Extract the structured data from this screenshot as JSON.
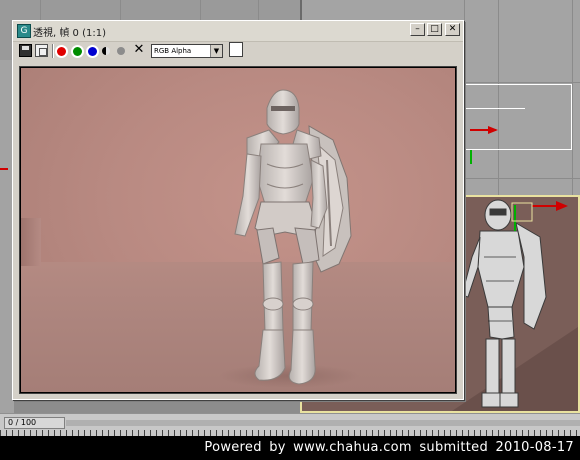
{
  "render_window": {
    "title": "透視, 幀 0 (1:1)",
    "app_icon_glyph": "G",
    "buttons": {
      "minimize": "–",
      "maximize": "□",
      "close": "✕"
    },
    "toolbar": {
      "channel_select": "RGB Alpha",
      "clear_glyph": "✕",
      "channels": [
        "red",
        "green",
        "blue",
        "monochrome",
        "alpha"
      ]
    }
  },
  "timeline": {
    "frame_counter": "0 / 100"
  },
  "watermark": {
    "text": "Powered by www.chahua.com submitted 2010-08-17"
  },
  "colors": {
    "render_background": "#b98a82",
    "viewport_background": "#a4a4a4",
    "active_viewport_border": "#e9e2a0",
    "axis_x": "#d00000",
    "axis_y": "#00b000"
  }
}
